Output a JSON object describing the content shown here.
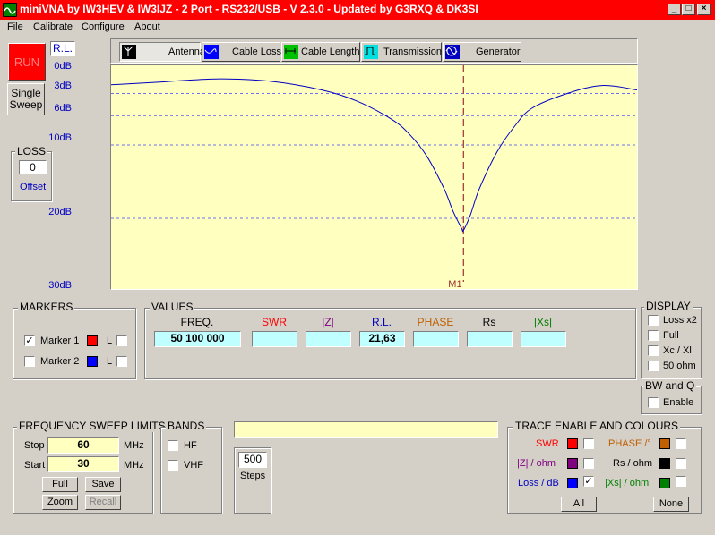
{
  "window": {
    "title": "miniVNA by IW3HEV & IW3IJZ - 2 Port - RS232/USB - V 2.3.0 - Updated by G3RXQ & DK3SI"
  },
  "menu": [
    "File",
    "Calibrate",
    "Configure",
    "About"
  ],
  "left": {
    "run_label": "RUN",
    "single_sweep_label": "Single\nSweep",
    "rl_label": "R.L.",
    "loss": {
      "title": "LOSS",
      "value": "0",
      "offset_label": "Offset"
    }
  },
  "toolbar": {
    "modes": [
      "Antenna",
      "Cable Loss",
      "Cable Length",
      "Transmission",
      "Generator"
    ],
    "selected": "Antenna"
  },
  "chart_data": {
    "type": "line",
    "ylabel": "R.L.",
    "y_ticks": [
      "0dB",
      "3dB",
      "6dB",
      "10dB",
      "20dB",
      "30dB"
    ],
    "y_tick_values": [
      0,
      3,
      6,
      10,
      20,
      30
    ],
    "ylim": [
      0,
      30
    ],
    "xlim": [
      30,
      60
    ],
    "x_unit": "MHz",
    "series": [
      {
        "color": "#0000c0",
        "x": [
          30,
          33,
          36,
          39,
          42,
          44,
          46,
          47,
          48,
          49,
          49.5,
          50,
          50.1,
          50.5,
          51,
          52,
          53,
          54,
          56,
          58,
          60
        ],
        "y": [
          1.8,
          1.4,
          1.0,
          1.3,
          2.5,
          4.0,
          6.5,
          8.5,
          11.5,
          16.0,
          19.0,
          21.4,
          21.63,
          19.5,
          16.0,
          11.0,
          7.5,
          5.0,
          3.0,
          1.9,
          2.5
        ]
      }
    ],
    "marker": {
      "label": "M1",
      "x": 50.1
    },
    "grid": true,
    "background": "#ffffc0"
  },
  "markers": {
    "title": "MARKERS",
    "items": [
      {
        "label": "Marker 1",
        "checked": "✓",
        "color": "#ff0000",
        "l_label": "L"
      },
      {
        "label": "Marker 2",
        "checked": "",
        "color": "#0000ff",
        "l_label": "L"
      }
    ]
  },
  "values": {
    "title": "VALUES",
    "headers": [
      {
        "label": "FREQ.",
        "color": "#000000"
      },
      {
        "label": "SWR",
        "color": "#ff0000"
      },
      {
        "label": "|Z|",
        "color": "#800080"
      },
      {
        "label": "R.L.",
        "color": "#0000c0"
      },
      {
        "label": "PHASE",
        "color": "#c06000"
      },
      {
        "label": "Rs",
        "color": "#000000"
      },
      {
        "label": "|Xs|",
        "color": "#008000"
      }
    ],
    "freq": "50 100 000",
    "swr": "",
    "z": "",
    "rl": "21,63",
    "phase": "",
    "rs": "",
    "xs": ""
  },
  "display": {
    "title": "DISPLAY",
    "options": [
      "Loss x2",
      "Full",
      "Xc / Xl",
      "50 ohm"
    ],
    "bwq_title": "BW and Q",
    "bwq_enable": "Enable"
  },
  "sweep": {
    "title": "FREQUENCY SWEEP LIMITS",
    "stop_label": "Stop",
    "stop_value": "60",
    "stop_unit": "MHz",
    "start_label": "Start",
    "start_value": "30",
    "start_unit": "MHz",
    "full": "Full",
    "save": "Save",
    "zoom": "Zoom",
    "recall": "Recall"
  },
  "bands": {
    "title": "BANDS",
    "hf": "HF",
    "vhf": "VHF"
  },
  "steps": {
    "value": "500",
    "label": "Steps"
  },
  "trace": {
    "title": "TRACE ENABLE AND COLOURS",
    "swr": {
      "label": "SWR",
      "color": "#ff0000",
      "swatch": "#ff0000",
      "checked": ""
    },
    "z": {
      "label": "|Z| / ohm",
      "color": "#800080",
      "swatch": "#800080",
      "checked": ""
    },
    "loss": {
      "label": "Loss / dB",
      "color": "#0000c0",
      "swatch": "#0000ff",
      "checked": "✓"
    },
    "phase": {
      "label": "PHASE /°",
      "color": "#c06000",
      "swatch": "#c06000",
      "checked": ""
    },
    "rs": {
      "label": "Rs / ohm",
      "color": "#000000",
      "swatch": "#000000",
      "checked": ""
    },
    "xs": {
      "label": "|Xs| / ohm",
      "color": "#008000",
      "swatch": "#008000",
      "checked": ""
    },
    "all": "All",
    "none": "None"
  }
}
